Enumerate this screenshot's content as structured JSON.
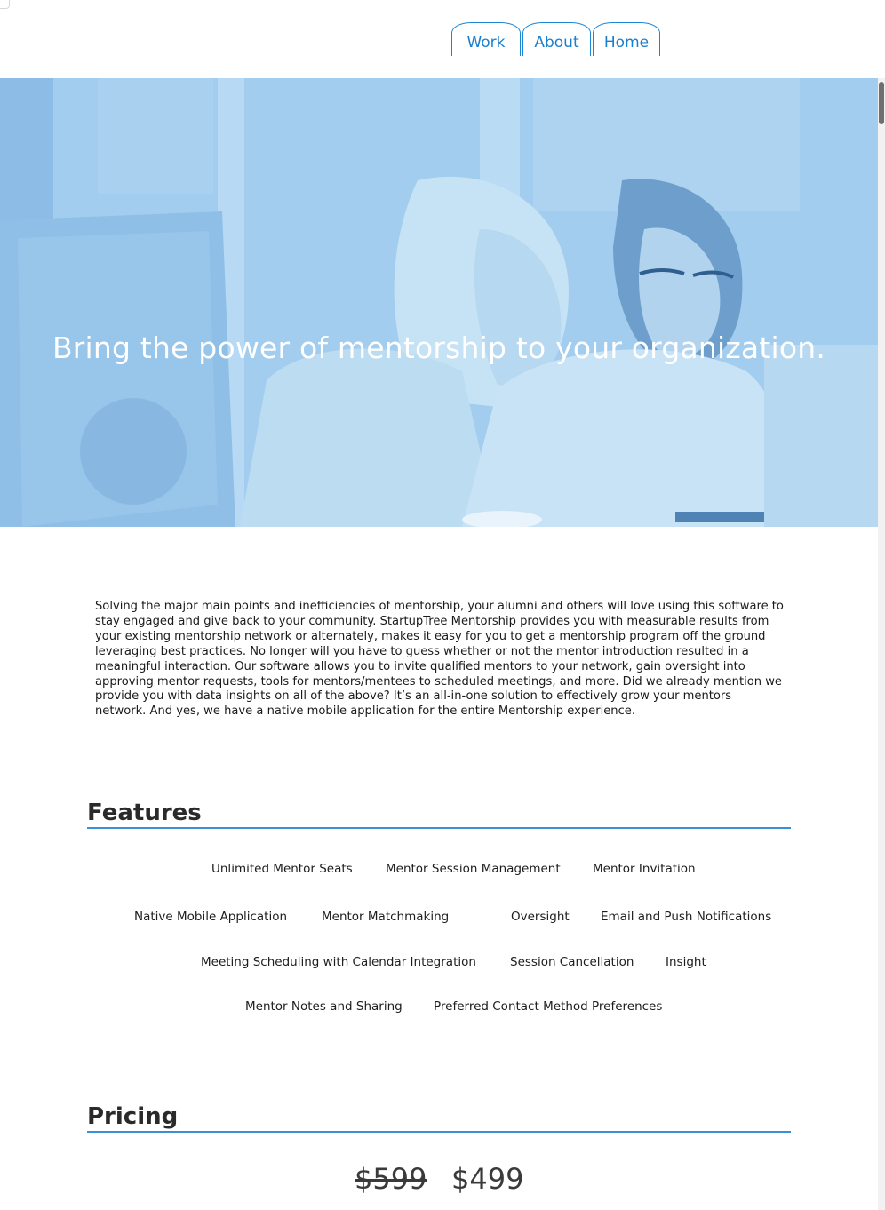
{
  "nav": {
    "items": [
      {
        "label": "Work"
      },
      {
        "label": "About"
      },
      {
        "label": "Home"
      }
    ]
  },
  "hero": {
    "title": "Bring the power of mentorship to your organization."
  },
  "intro": {
    "text": "Solving the major main points and inefficiencies of mentorship, your alumni and others will love using this software to stay engaged and give back to your community. StartupTree Mentorship provides you with measurable results from your existing mentorship network or alternately, makes it easy for you to get a mentorship program off the ground leveraging best practices. No longer will you have to guess whether or not the mentor introduction resulted in a meaningful interaction. Our software allows you to invite qualified mentors to your network, gain oversight into approving mentor requests, tools for mentors/mentees to scheduled meetings, and more. Did we already mention we provide you with data insights on all of the above? It’s an all-in-one solution to effectively grow your mentors network. And yes, we have a native mobile application for the entire Mentorship experience."
  },
  "features": {
    "title": "Features",
    "items": [
      "Unlimited Mentor Seats",
      "Mentor Session Management",
      "Mentor Invitation",
      "Native Mobile Application",
      "Mentor Matchmaking",
      "Oversight",
      "Email and Push Notifications",
      "Meeting Scheduling with Calendar Integration",
      "Session Cancellation",
      "Insight",
      "Mentor Notes and Sharing",
      "Preferred Contact Method Preferences"
    ]
  },
  "pricing": {
    "title": "Pricing",
    "old_price": "$599",
    "new_price": "$499"
  },
  "colors": {
    "accent": "#1b7fcf",
    "hero_overlay": "#9cc8ea"
  }
}
